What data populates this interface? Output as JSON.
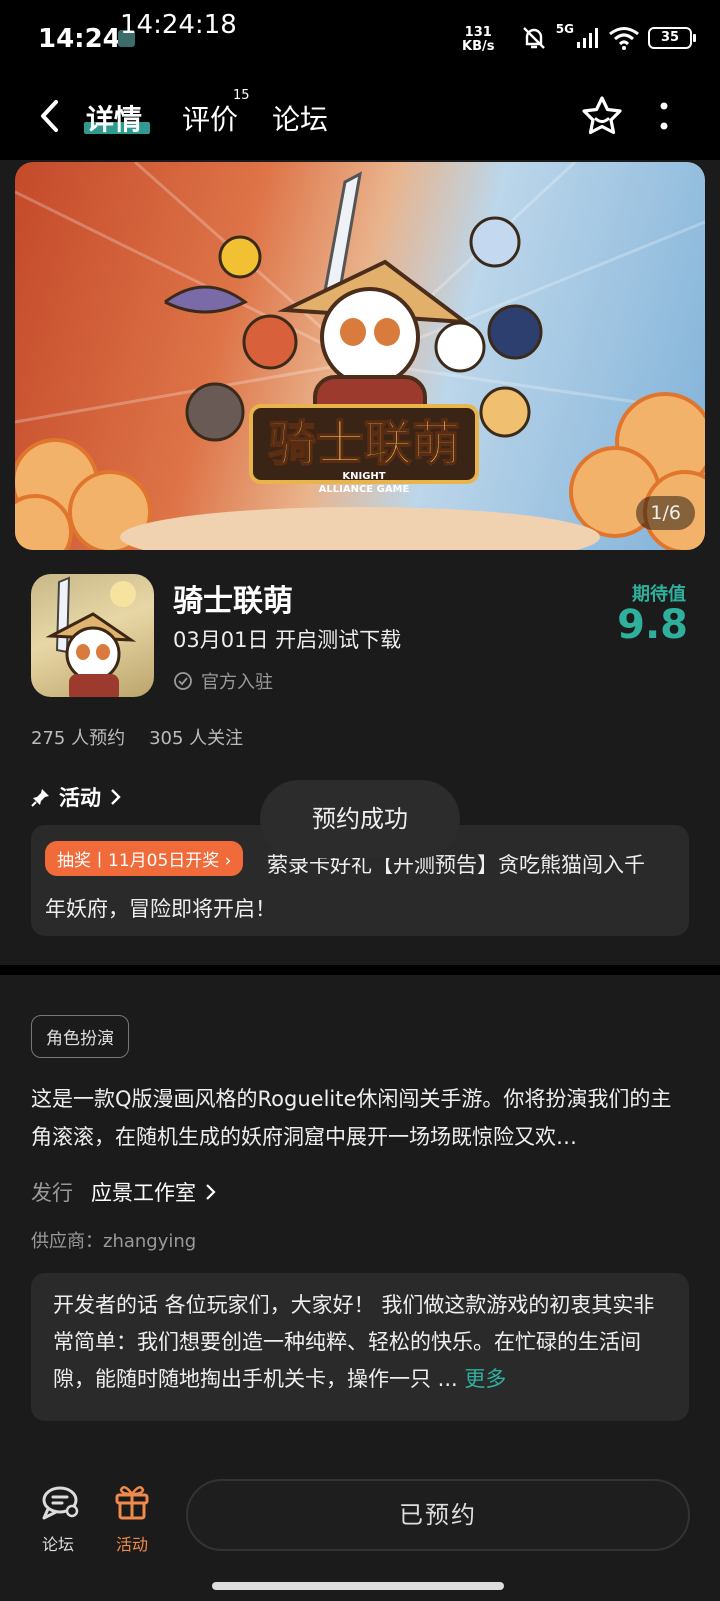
{
  "status": {
    "time": "14:24",
    "clock_overlay": "14:24:18",
    "net_speed_value": "131",
    "net_speed_unit": "KB/s",
    "network_type": "5G",
    "battery": "35"
  },
  "nav": {
    "tabs": [
      {
        "label": "详情"
      },
      {
        "label": "评价",
        "badge": "15"
      },
      {
        "label": "论坛"
      }
    ]
  },
  "banner": {
    "logo_text": "骑士联萌",
    "logo_sub_1": "KNIGHT",
    "logo_sub_2": "ALLIANCE GAME",
    "counter": "1/6"
  },
  "game": {
    "title": "骑士联萌",
    "test_date": "03月01日 开启测试下载",
    "official": "官方入驻",
    "expect_label": "期待值",
    "expect_score": "9.8",
    "reservations": "275 人预约",
    "followers": "305 人关注"
  },
  "activity": {
    "header": "活动",
    "tag": "抽奖丨11月05日开奖 ›",
    "text": "萦录卡好礼【开测预告】贪吃熊猫闯入千年妖府，冒险即将开启！",
    "toast": "预约成功"
  },
  "details": {
    "genre": "角色扮演",
    "description": "这是一款Q版漫画风格的Roguelite休闲闯关手游。你将扮演我们的主角滚滚，在随机生成的妖府洞窟中展开一场场既惊险又欢…",
    "publisher_label": "发行",
    "publisher_name": "应景工作室",
    "supplier": "供应商：zhangying",
    "dev_words": "开发者的话  各位玩家们，大家好！ 我们做这款游戏的初衷其实非常简单：我们想要创造一种纯粹、轻松的快乐。在忙碌的生活间隙，能随时随地掏出手机关卡，操作一只 ... ",
    "more": "更多"
  },
  "bottom": {
    "forum_label": "论坛",
    "activity_label": "活动",
    "reserved_label": "已预约"
  },
  "colors": {
    "accent": "#2fb09d",
    "orange": "#f06a3a"
  }
}
